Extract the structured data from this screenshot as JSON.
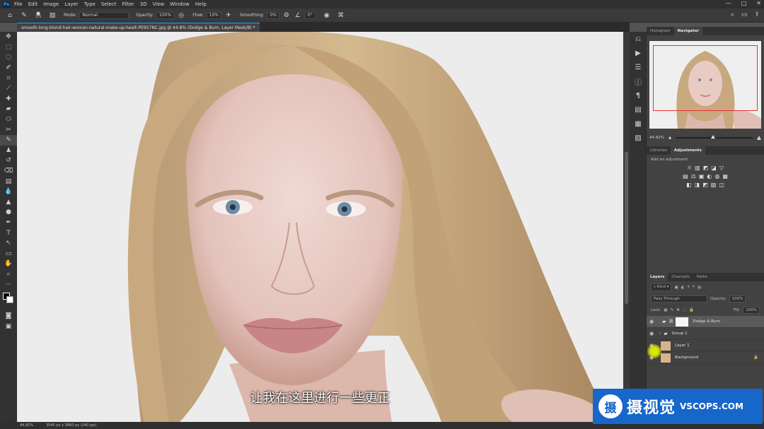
{
  "app": {
    "logo": "Ps",
    "menu": [
      "File",
      "Edit",
      "Image",
      "Layer",
      "Type",
      "Select",
      "Filter",
      "3D",
      "View",
      "Window",
      "Help"
    ],
    "window_controls": [
      "—",
      "□",
      "✕"
    ]
  },
  "options_bar": {
    "brush_size": "175",
    "mode_label": "Mode:",
    "mode_value": "Normal",
    "opacity_label": "Opacity:",
    "opacity_value": "100%",
    "flow_label": "Flow:",
    "flow_value": "10%",
    "smoothing_label": "Smoothing:",
    "smoothing_value": "0%",
    "angle_value": "0°"
  },
  "document": {
    "tab_title": "smooth-long-blond-hair-woman-natural-make-up-healt-PE957NC.jpg @ 44.8% (Dodge & Burn, Layer Mask/8) *"
  },
  "status": {
    "zoom": "44.82%",
    "doc_info": "3545 px x 3860 px (240 ppi)"
  },
  "navigator": {
    "tabs": [
      "Histogram",
      "Navigator"
    ],
    "active_tab": "Navigator",
    "zoom": "44.82%"
  },
  "adjustments": {
    "tabs": [
      "Libraries",
      "Adjustments"
    ],
    "active_tab": "Adjustments",
    "title": "Add an adjustment",
    "rows": [
      [
        "☼",
        "▥",
        "◩",
        "◪",
        "▽"
      ],
      [
        "▤",
        "⚖",
        "▣",
        "◐",
        "◍",
        "▦"
      ],
      [
        "◧",
        "◨",
        "◩",
        "▨",
        "◫"
      ]
    ]
  },
  "layers_panel": {
    "tabs": [
      "Layers",
      "Channels",
      "Paths"
    ],
    "active_tab": "Layers",
    "filter_kind": "Kind",
    "blend_mode": "Pass Through",
    "opacity_label": "Opacity:",
    "opacity_value": "100%",
    "lock_label": "Lock:",
    "fill_label": "Fill:",
    "fill_value": "100%",
    "layers": [
      {
        "name": "Dodge & Burn",
        "type": "group-mask",
        "selected": true
      },
      {
        "name": "Group 1",
        "type": "group",
        "selected": false
      },
      {
        "name": "Layer 1",
        "type": "pixel",
        "selected": false
      },
      {
        "name": "Background",
        "type": "pixel",
        "selected": false
      }
    ]
  },
  "subtitle": "让我在这里进行一些更正",
  "watermark": {
    "logo_char": "摄",
    "cn": "摄视觉",
    "en": "VSCOPS.COM"
  },
  "colors": {
    "accent": "#31a8ff",
    "watermark_blue": "#1766c9",
    "nav_view_box": "#e53333"
  }
}
